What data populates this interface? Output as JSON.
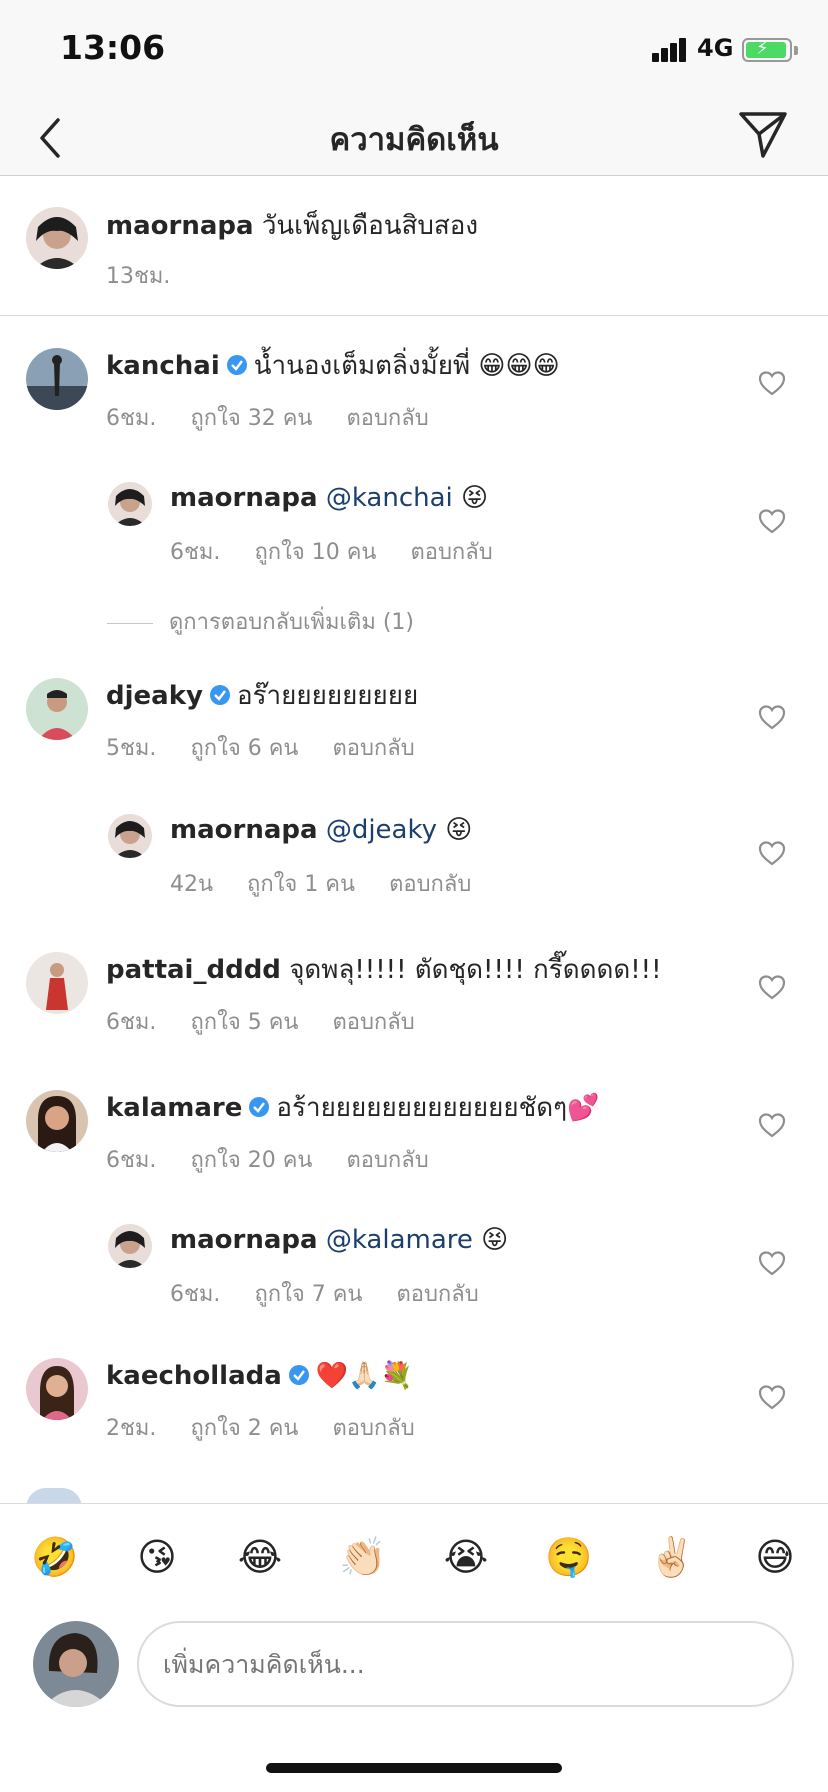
{
  "status_bar": {
    "time": "13:06",
    "network": "4G"
  },
  "nav": {
    "title": "ความคิดเห็น"
  },
  "caption": {
    "username": "maornapa",
    "text": "วันเพ็ญเดือนสิบสอง",
    "time": "13ชม."
  },
  "comments": [
    {
      "username": "kanchai",
      "verified": true,
      "text": "น้ำนองเต็มตลิ่งมั้ยพี่ 😁😁😁",
      "time": "6ชม.",
      "likes": "ถูกใจ 32 คน",
      "reply": "ตอบกลับ"
    },
    {
      "username": "maornapa",
      "mention": "@kanchai",
      "text": "😝",
      "time": "6ชม.",
      "likes": "ถูกใจ 10 คน",
      "reply": "ตอบกลับ"
    },
    {
      "username": "djeaky",
      "verified": true,
      "text": "อร๊ายยยยยยยยย",
      "time": "5ชม.",
      "likes": "ถูกใจ 6 คน",
      "reply": "ตอบกลับ"
    },
    {
      "username": "maornapa",
      "mention": "@djeaky",
      "text": "😝",
      "time": "42น",
      "likes": "ถูกใจ 1 คน",
      "reply": "ตอบกลับ"
    },
    {
      "username": "pattai_dddd",
      "verified": false,
      "text": "จุดพลุ!!!!! ตัดชุด!!!! กรี๊ดดดด!!!",
      "time": "6ชม.",
      "likes": "ถูกใจ 5 คน",
      "reply": "ตอบกลับ"
    },
    {
      "username": "kalamare",
      "verified": true,
      "text": "อร้ายยยยยยยยยยยยยชัดๆ💕",
      "time": "6ชม.",
      "likes": "ถูกใจ 20 คน",
      "reply": "ตอบกลับ"
    },
    {
      "username": "maornapa",
      "mention": "@kalamare",
      "text": "😝",
      "time": "6ชม.",
      "likes": "ถูกใจ 7 คน",
      "reply": "ตอบกลับ"
    },
    {
      "username": "kaechollada",
      "verified": true,
      "text": "❤️🙏🏻💐",
      "time": "2ชม.",
      "likes": "ถูกใจ 2 คน",
      "reply": "ตอบกลับ"
    }
  ],
  "more_replies": "ดูการตอบกลับเพิ่มเติม (1)",
  "emoji_bar": [
    "🤣",
    "😘",
    "😂",
    "👏🏻",
    "😭",
    "🤤",
    "✌🏻",
    "😅"
  ],
  "composer": {
    "placeholder": "เพิ่มความคิดเห็น..."
  },
  "colors": {
    "mention": "#1c3f6e",
    "verified": "#3897f0",
    "meta": "#8e8e8e"
  }
}
